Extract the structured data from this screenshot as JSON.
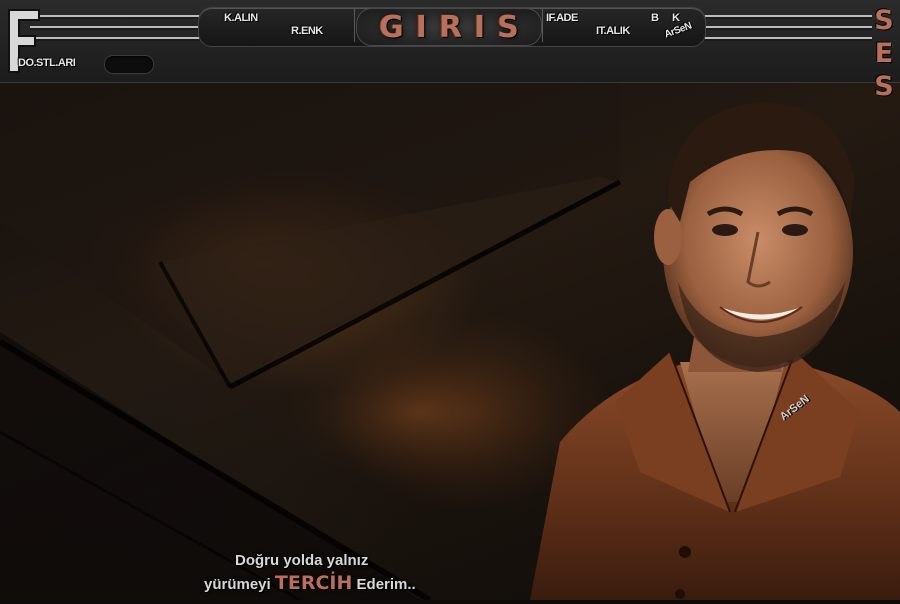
{
  "toolbar": {
    "big_letter": "F",
    "dostlari": "DO.STL.ARI",
    "kalin": "K.ALIN",
    "renk": "R.ENK",
    "giris": "GIRIS",
    "ifade": "IF.ADE",
    "italik": "IT.ALIK",
    "b": "B",
    "k": "K",
    "arsen": "ArSeN",
    "ses": [
      "S",
      "E",
      "S"
    ]
  },
  "portrait": {
    "watermark": "ArSeN"
  },
  "quote": {
    "line1": "Doğru yolda yalnız",
    "line2_before": "yürümeyi ",
    "line2_highlight": "TERCİH",
    "line2_after": " Ederim.."
  },
  "colors": {
    "accent": "#b8705a",
    "toolbar": "#242424",
    "background": "#1a130d"
  }
}
